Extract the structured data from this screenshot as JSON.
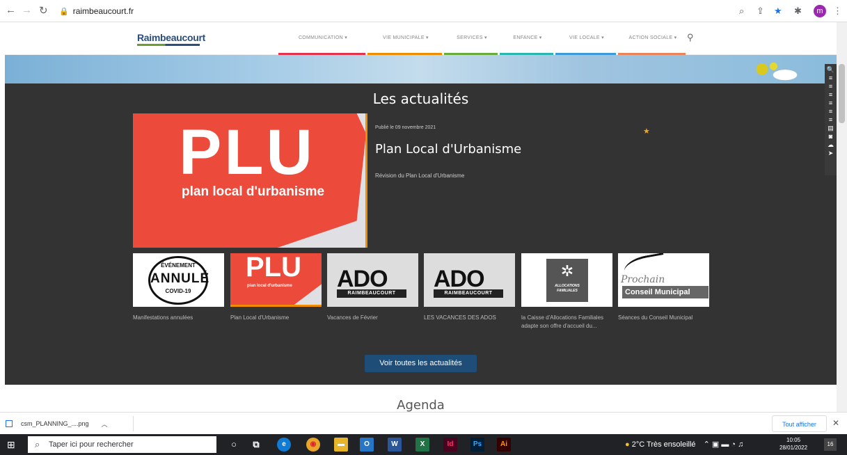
{
  "browser": {
    "url": "raimbeaucourt.fr",
    "avatar_letter": "m"
  },
  "site": {
    "logo_text": "Raimbeaucourt",
    "menu": [
      {
        "label": "COMMUNICATION ▾",
        "color": "#e3324b"
      },
      {
        "label": "VIE MUNICIPALE ▾",
        "color": "#f08c00"
      },
      {
        "label": "SERVICES ▾",
        "color": "#6aaa3c"
      },
      {
        "label": "ENFANCE ▾",
        "color": "#2bb5b0"
      },
      {
        "label": "VIE LOCALE ▾",
        "color": "#3c9ad9"
      },
      {
        "label": "ACTION SOCIALE ▾",
        "color": "#e9835a"
      }
    ],
    "section_title": "Les actualités",
    "featured": {
      "image_big": "PLU",
      "image_sub": "plan local d'urbanisme",
      "date": "Publié le 09 novembre 2021",
      "title": "Plan Local d'Urbanisme",
      "description": "Révision du Plan Local d'Urbanisme"
    },
    "thumbs": [
      {
        "caption": "Manifestations annulées",
        "img_t1": "ÉVÉNEMENT",
        "img_t2": "ANNULÉ",
        "img_t3": "COVID-19"
      },
      {
        "caption": "Plan Local d'Urbanisme",
        "img_t1": "PLU",
        "img_t2": "plan local d'urbanisme"
      },
      {
        "caption": "Vacances de Février",
        "img_t1": "ADO",
        "img_t2": "RAIMBEAUCOURT"
      },
      {
        "caption": "LES VACANCES DES ADOS",
        "img_t1": "ADO",
        "img_t2": "RAIMBEAUCOURT"
      },
      {
        "caption": "la Caisse d'Allocations Familiales adapte son offre d'accueil du...",
        "img_t1": "ALLOCATIONS FAMILIALES"
      },
      {
        "caption": "Séances du Conseil Municipal",
        "img_t1": "Prochain",
        "img_t2": "Conseil Municipal"
      }
    ],
    "all_news_button": "Voir toutes les actualités",
    "next_section": "Agenda"
  },
  "download": {
    "file": "csm_PLANNING_....png",
    "show_all": "Tout afficher"
  },
  "taskbar": {
    "search_placeholder": "Taper ici pour rechercher",
    "weather": "2°C  Très ensoleillé",
    "time": "10:05",
    "date": "28/01/2022",
    "notifications": "16",
    "apps": [
      {
        "label": "Id",
        "color": "#49021f",
        "fg": "#ff3366"
      },
      {
        "label": "Ps",
        "color": "#001e36",
        "fg": "#31a8ff"
      },
      {
        "label": "Ai",
        "color": "#330000",
        "fg": "#ff9a00"
      }
    ]
  }
}
